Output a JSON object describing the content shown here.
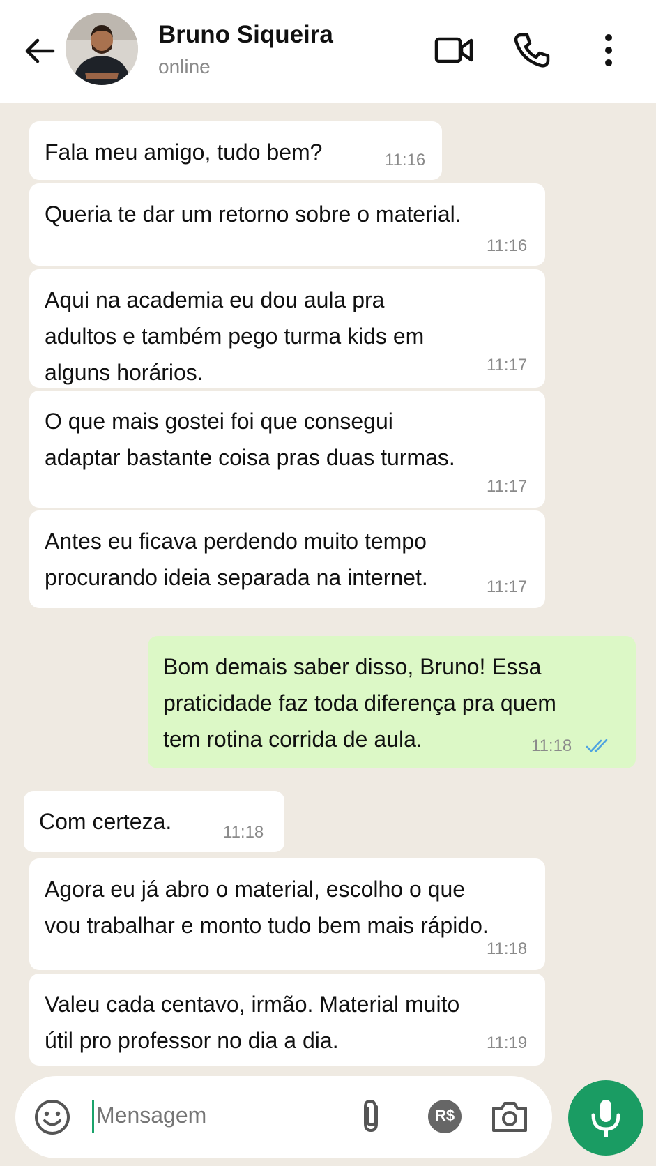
{
  "header": {
    "contact_name": "Bruno Siqueira",
    "status": "online",
    "icons": [
      "back-arrow-icon",
      "video-call-icon",
      "phone-icon",
      "more-options-icon"
    ]
  },
  "messages": [
    {
      "direction": "in",
      "text": "Fala meu amigo, tudo bem?",
      "time": "11:16"
    },
    {
      "direction": "in",
      "text": "Queria te dar um retorno sobre o material.",
      "time": "11:16"
    },
    {
      "direction": "in",
      "text": "Aqui na academia eu dou aula pra\nadultos e também pego turma kids em\nalguns horários.",
      "time": "11:17"
    },
    {
      "direction": "in",
      "text": "O que mais gostei foi que consegui\nadaptar bastante coisa pras duas turmas.",
      "time": "11:17"
    },
    {
      "direction": "in",
      "text": "Antes eu ficava perdendo muito tempo\nprocurando ideia separada na internet.",
      "time": "11:17"
    },
    {
      "direction": "out",
      "text": "Bom demais saber disso, Bruno! Essa\npraticidade faz toda diferença pra quem\ntem rotina corrida de aula.",
      "time": "11:18",
      "read": true
    },
    {
      "direction": "in",
      "text": "Com certeza.",
      "time": "11:18"
    },
    {
      "direction": "in",
      "text": "Agora eu já abro o material, escolho o que\nvou trabalhar e monto tudo bem mais rápido.",
      "time": "11:18"
    },
    {
      "direction": "in",
      "text": "Valeu cada centavo, irmão. Material muito\nútil pro professor no dia a dia.",
      "time": "11:19"
    }
  ],
  "composer": {
    "placeholder": "Mensagem",
    "icons": [
      "emoji-icon",
      "attach-icon",
      "payment-icon",
      "camera-icon",
      "mic-icon"
    ],
    "payment_label": "R$"
  },
  "colors": {
    "incoming_bubble": "#ffffff",
    "outgoing_bubble": "#dcf8c6",
    "chat_background": "#efeae2",
    "accent": "#1a9c63",
    "read_checks": "#4fa3e0"
  }
}
